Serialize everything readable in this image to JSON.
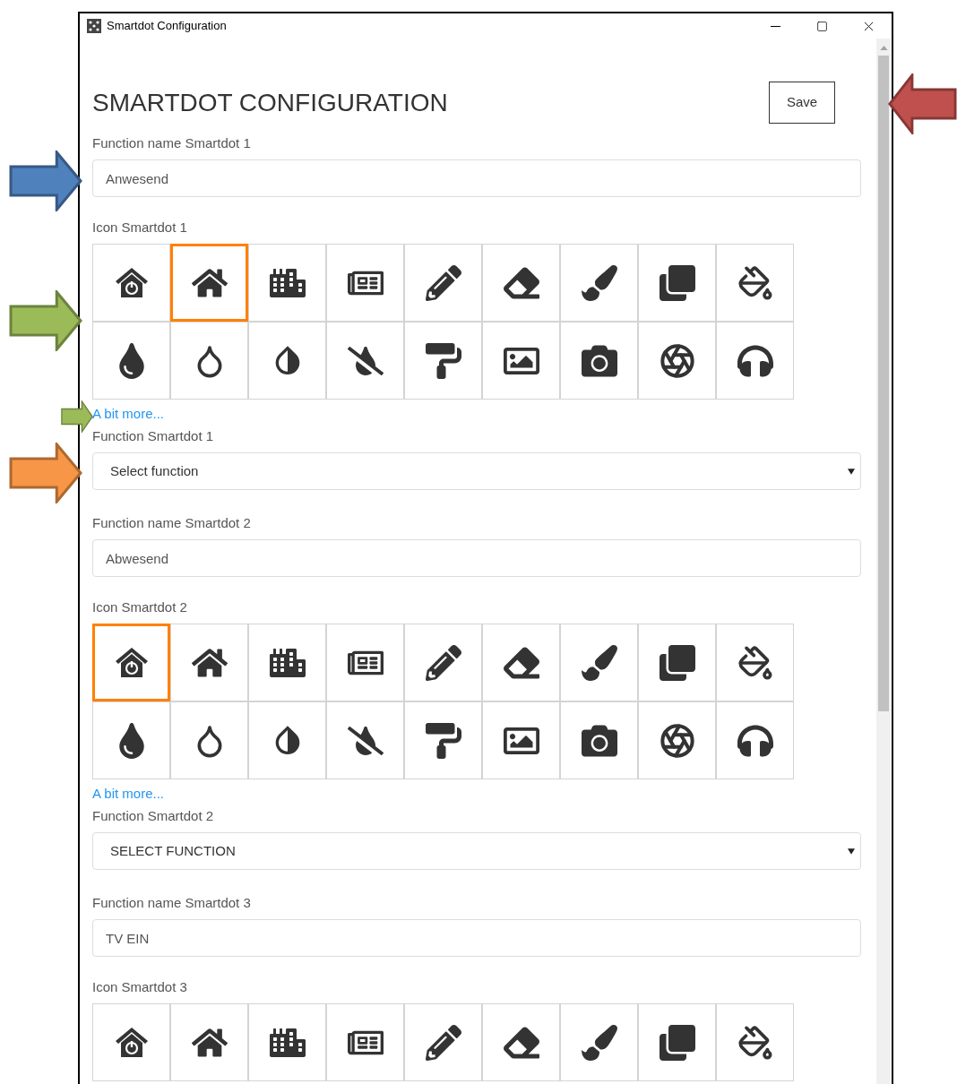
{
  "window": {
    "title": "Smartdot Configuration"
  },
  "heading": "SMARTDOT CONFIGURATION",
  "save_button": "Save",
  "smartdots": [
    {
      "name_label": "Function name Smartdot 1",
      "name_value": "Anwesend",
      "icon_label": "Icon Smartdot 1",
      "icons": [
        {
          "selected": false
        },
        {
          "selected": true
        },
        {
          "selected": false
        },
        {
          "selected": false
        },
        {
          "selected": false
        },
        {
          "selected": false
        },
        {
          "selected": false
        },
        {
          "selected": false
        },
        {
          "selected": false
        },
        {
          "selected": false
        },
        {
          "selected": false
        },
        {
          "selected": false
        },
        {
          "selected": false
        },
        {
          "selected": false
        },
        {
          "selected": false
        },
        {
          "selected": false
        },
        {
          "selected": false
        },
        {
          "selected": false
        }
      ],
      "more_link": "A bit more...",
      "function_label": "Function Smartdot 1",
      "function_value": "Select function"
    },
    {
      "name_label": "Function name Smartdot 2",
      "name_value": "Abwesend",
      "icon_label": "Icon Smartdot 2",
      "icons": [
        {
          "selected": true
        },
        {
          "selected": false
        },
        {
          "selected": false
        },
        {
          "selected": false
        },
        {
          "selected": false
        },
        {
          "selected": false
        },
        {
          "selected": false
        },
        {
          "selected": false
        },
        {
          "selected": false
        },
        {
          "selected": false
        },
        {
          "selected": false
        },
        {
          "selected": false
        },
        {
          "selected": false
        },
        {
          "selected": false
        },
        {
          "selected": false
        },
        {
          "selected": false
        },
        {
          "selected": false
        },
        {
          "selected": false
        }
      ],
      "more_link": "A bit more...",
      "function_label": "Function Smartdot 2",
      "function_value": "SELECT FUNCTION"
    },
    {
      "name_label": "Function name Smartdot 3",
      "name_value": "TV EIN",
      "icon_label": "Icon Smartdot 3",
      "icons": [
        {
          "selected": false
        },
        {
          "selected": false
        },
        {
          "selected": false
        },
        {
          "selected": false
        },
        {
          "selected": false
        },
        {
          "selected": false
        },
        {
          "selected": false
        },
        {
          "selected": false
        },
        {
          "selected": false
        }
      ]
    }
  ],
  "annotations": [
    {
      "kind": "right-arrow",
      "color": "#4f81bd"
    },
    {
      "kind": "right-arrow",
      "color": "#9bbb59"
    },
    {
      "kind": "right-arrow",
      "color": "#9bbb59"
    },
    {
      "kind": "right-arrow",
      "color": "#f79646"
    },
    {
      "kind": "left-arrow",
      "color": "#c0504d"
    }
  ]
}
